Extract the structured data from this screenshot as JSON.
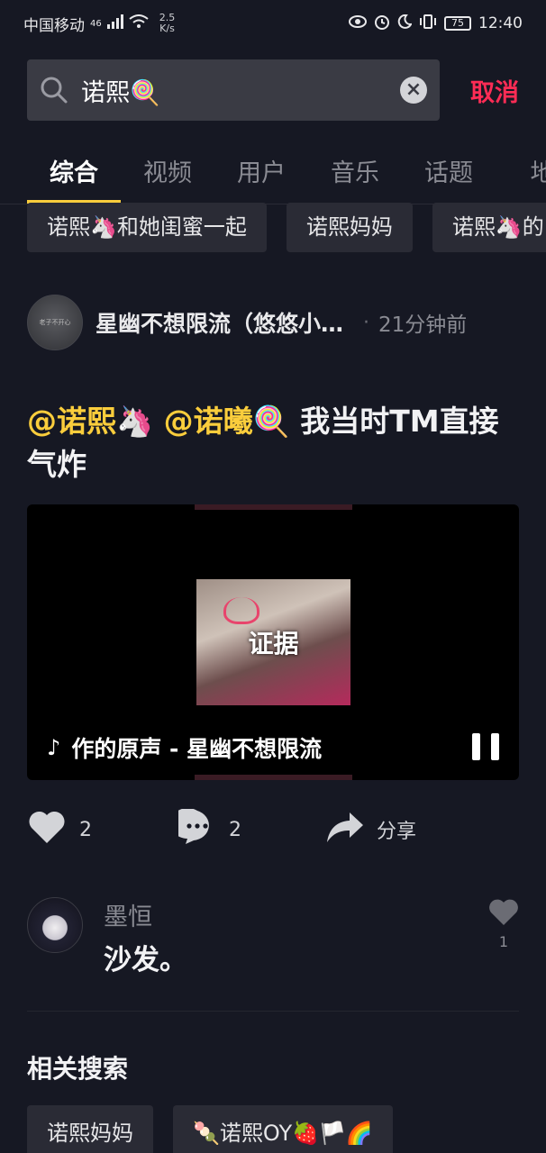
{
  "status_bar": {
    "carrier": "中国移动",
    "signal": "46",
    "net_speed_value": "2.5",
    "net_speed_unit": "K/s",
    "battery": "75",
    "time": "12:40"
  },
  "search": {
    "query": "诺熙🍭",
    "clear_symbol": "×",
    "cancel_label": "取消"
  },
  "tabs": [
    {
      "label": "综合"
    },
    {
      "label": "视频"
    },
    {
      "label": "用户"
    },
    {
      "label": "音乐"
    },
    {
      "label": "话题"
    },
    {
      "label": "地"
    }
  ],
  "chips": [
    {
      "label": "诺熙🦄和她闺蜜一起"
    },
    {
      "label": "诺熙妈妈"
    },
    {
      "label": "诺熙🦄的"
    }
  ],
  "post": {
    "author_avatar_text": "老子不开心",
    "author": "星幽不想限流（悠悠小…",
    "separator": "·",
    "time": "21分钟前",
    "mention1": "@诺熙🦄",
    "mention2": "@诺曦🍭",
    "text": "我当时TM直接气炸",
    "video_label": "证据",
    "music_note": "♪",
    "music_text": "作的原声 - 星幽不想限流"
  },
  "actions": {
    "like_count": "2",
    "comment_count": "2",
    "share_label": "分享"
  },
  "comment": {
    "user": "墨恒",
    "text": "沙发。",
    "like_count": "1"
  },
  "related": {
    "title": "相关搜索",
    "items": [
      {
        "label": "诺熙妈妈"
      },
      {
        "label": "🍡诺熙OY🍓🏳️🌈"
      }
    ]
  },
  "colors": {
    "background": "#161823",
    "accent_red": "#fe2c55",
    "accent_yellow": "#facd3c"
  }
}
